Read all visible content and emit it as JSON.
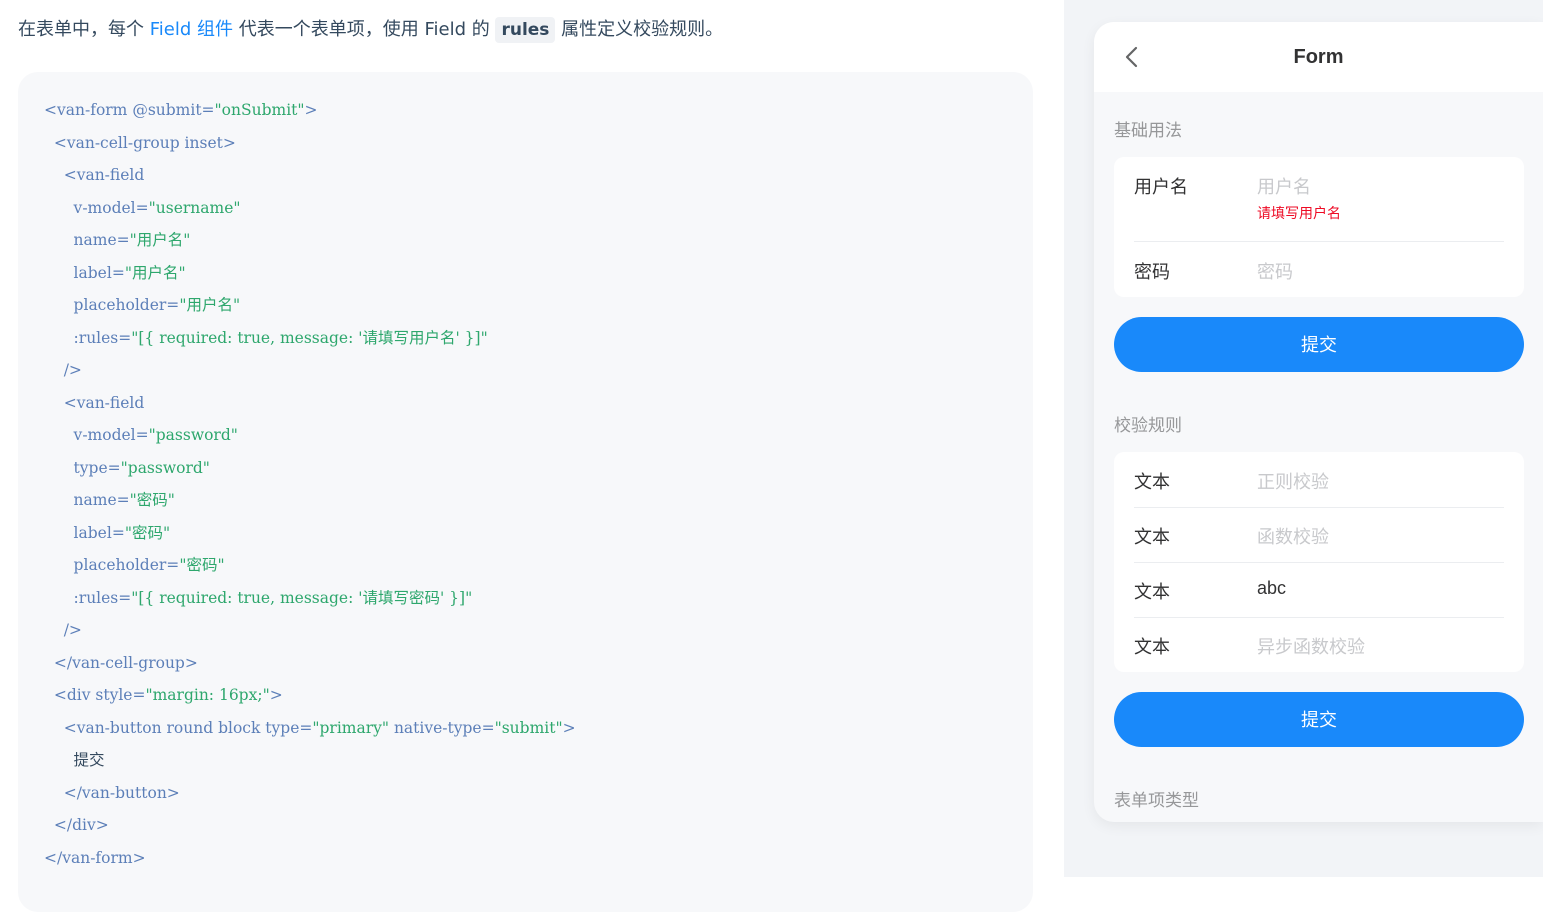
{
  "intro": {
    "part1": "在表单中，每个 ",
    "link": "Field 组件",
    "part2": " 代表一个表单项，使用 Field 的 ",
    "code": "rules",
    "part3": " 属性定义校验规则。"
  },
  "code_lines": [
    [
      [
        "t",
        "<van-form "
      ],
      [
        "t",
        "@submit="
      ],
      [
        "s",
        "\"onSubmit\""
      ],
      [
        "t",
        ">"
      ]
    ],
    [
      [
        "t",
        "  <van-cell-group inset>"
      ]
    ],
    [
      [
        "t",
        "    <van-field"
      ]
    ],
    [
      [
        "t",
        "      v-model="
      ],
      [
        "s",
        "\"username\""
      ]
    ],
    [
      [
        "t",
        "      name="
      ],
      [
        "s",
        "\"用户名\""
      ]
    ],
    [
      [
        "t",
        "      label="
      ],
      [
        "s",
        "\"用户名\""
      ]
    ],
    [
      [
        "t",
        "      placeholder="
      ],
      [
        "s",
        "\"用户名\""
      ]
    ],
    [
      [
        "t",
        "      :rules="
      ],
      [
        "s",
        "\"[{ required: true, message: '请填写用户名' }]\""
      ]
    ],
    [
      [
        "t",
        "    />"
      ]
    ],
    [
      [
        "t",
        "    <van-field"
      ]
    ],
    [
      [
        "t",
        "      v-model="
      ],
      [
        "s",
        "\"password\""
      ]
    ],
    [
      [
        "t",
        "      type="
      ],
      [
        "s",
        "\"password\""
      ]
    ],
    [
      [
        "t",
        "      name="
      ],
      [
        "s",
        "\"密码\""
      ]
    ],
    [
      [
        "t",
        "      label="
      ],
      [
        "s",
        "\"密码\""
      ]
    ],
    [
      [
        "t",
        "      placeholder="
      ],
      [
        "s",
        "\"密码\""
      ]
    ],
    [
      [
        "t",
        "      :rules="
      ],
      [
        "s",
        "\"[{ required: true, message: '请填写密码' }]\""
      ]
    ],
    [
      [
        "t",
        "    />"
      ]
    ],
    [
      [
        "t",
        "  </van-cell-group>"
      ]
    ],
    [
      [
        "t",
        "  <div style="
      ],
      [
        "s",
        "\"margin: 16px;\""
      ],
      [
        "t",
        ">"
      ]
    ],
    [
      [
        "t",
        "    <van-button round block type="
      ],
      [
        "s",
        "\"primary\""
      ],
      [
        "t",
        " native-type="
      ],
      [
        "s",
        "\"submit\""
      ],
      [
        "t",
        ">"
      ]
    ],
    [
      [
        "plain",
        "      提交"
      ]
    ],
    [
      [
        "t",
        "    </van-button>"
      ]
    ],
    [
      [
        "t",
        "  </div>"
      ]
    ],
    [
      [
        "t",
        "</van-form>"
      ]
    ]
  ],
  "phone": {
    "nav_title": "Form",
    "section_basic": "基础用法",
    "username_label": "用户名",
    "username_placeholder": "用户名",
    "username_error": "请填写用户名",
    "password_label": "密码",
    "password_placeholder": "密码",
    "submit_1": "提交",
    "section_rules": "校验规则",
    "rules_fields": [
      {
        "label": "文本",
        "value": "正则校验",
        "filled": false
      },
      {
        "label": "文本",
        "value": "函数校验",
        "filled": false
      },
      {
        "label": "文本",
        "value": "abc",
        "filled": true
      },
      {
        "label": "文本",
        "value": "异步函数校验",
        "filled": false
      }
    ],
    "submit_2": "提交",
    "section_types": "表单项类型"
  },
  "colors": {
    "primary": "#1989fa",
    "error": "#ee0a24",
    "code_tag": "#5c7fb8",
    "code_string": "#2ea76d"
  },
  "icons": {
    "back": "chevron-left-icon"
  }
}
